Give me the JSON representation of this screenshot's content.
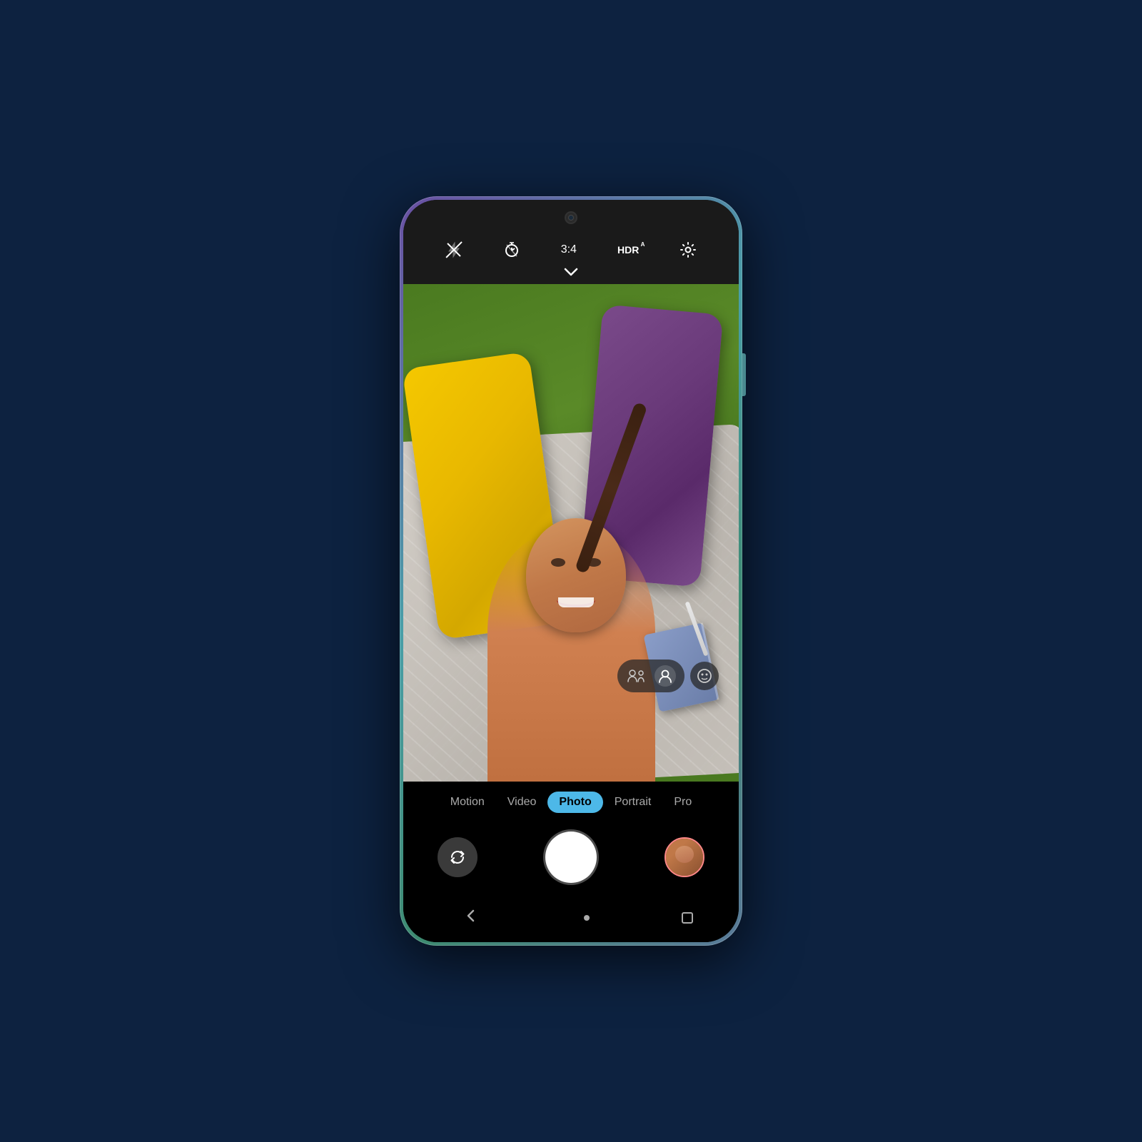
{
  "phone": {
    "title": "Camera App"
  },
  "status_bar": {
    "camera_dot": "front-camera"
  },
  "camera_controls": {
    "flash_icon": "✕",
    "flash_label": "Flash Off",
    "timer_icon": "⏱",
    "timer_label": "Timer",
    "ratio": "3:4",
    "hdr": "HDR",
    "hdr_sup": "A",
    "settings_icon": "⚙",
    "settings_label": "Settings",
    "chevron": "∨"
  },
  "ai_suggestions": {
    "icon_group_label": "AI portrait suggestions",
    "icon1_label": "group portrait",
    "icon2_label": "single portrait",
    "icon3_label": "face filter"
  },
  "camera_modes": {
    "items": [
      {
        "id": "motion",
        "label": "Motion",
        "active": false
      },
      {
        "id": "video",
        "label": "Video",
        "active": false
      },
      {
        "id": "photo",
        "label": "Photo",
        "active": true
      },
      {
        "id": "portrait",
        "label": "Portrait",
        "active": false
      },
      {
        "id": "pro",
        "label": "Pro",
        "active": false
      }
    ]
  },
  "camera_actions": {
    "flip_label": "Flip Camera",
    "shutter_label": "Take Photo",
    "gallery_label": "Gallery"
  },
  "bottom_nav": {
    "back_label": "Back",
    "home_label": "Home",
    "recents_label": "Recents"
  }
}
